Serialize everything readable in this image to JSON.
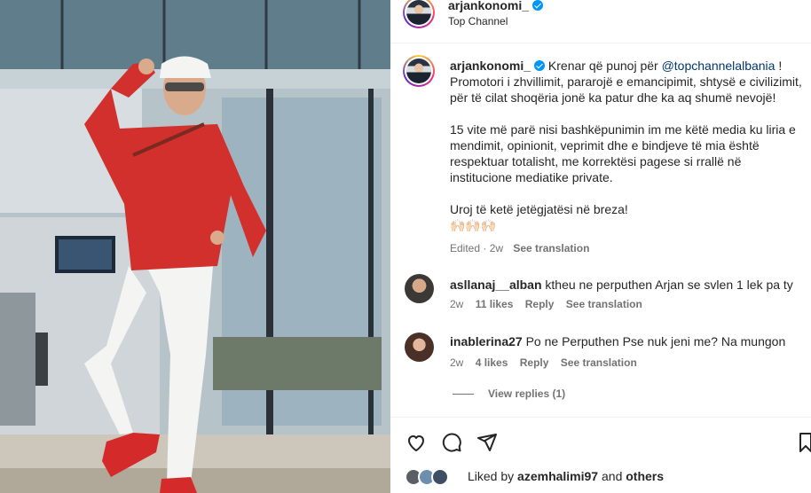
{
  "post": {
    "author": "arjankonomi_",
    "location": "Top Channel",
    "caption_mention": "@topchannelalbania",
    "caption_lead": "Krenar që punoj për",
    "caption_rest": " ! Promotori i zhvillimit, pararojë e emancipimit, shtysë e civilizimit, për të cilat shoqëria jonë ka patur dhe ka aq shumë nevojë!",
    "caption_p2": "15 vite më parë nisi bashkëpunimin im me këtë media ku liria e mendimit, opinionit, veprimit dhe e bindjeve të mia është respektuar totalisht, me korrektësi pagese si rrallë në institucione mediatike private.",
    "caption_p3": "Uroj të ketë jetëgjatësi në breza!",
    "caption_emoji": "🙌🏻🙌🏻🙌🏻",
    "edited": "Edited · 2w",
    "see_translation": "See translation"
  },
  "comments": [
    {
      "user": "asllanaj__alban",
      "text": "ktheu ne perputhen Arjan se svlen 1 lek pa ty",
      "age": "2w",
      "likes": "11 likes",
      "reply": "Reply",
      "translate": "See translation"
    },
    {
      "user": "inablerina27",
      "text": "Po ne Perputhen Pse nuk jeni me? Na mungon",
      "age": "2w",
      "likes": "4 likes",
      "reply": "Reply",
      "translate": "See translation"
    }
  ],
  "view_replies": "View replies (1)",
  "liked_by": {
    "prefix": "Liked by",
    "user": "azemhalimi97",
    "joiner": "and",
    "others": "others"
  },
  "icons": [
    "heart-icon",
    "comment-icon",
    "share-icon",
    "bookmark-icon",
    "verified-icon"
  ],
  "colors": {
    "link": "#00376b",
    "muted": "#737373",
    "verified": "#0095f6"
  }
}
